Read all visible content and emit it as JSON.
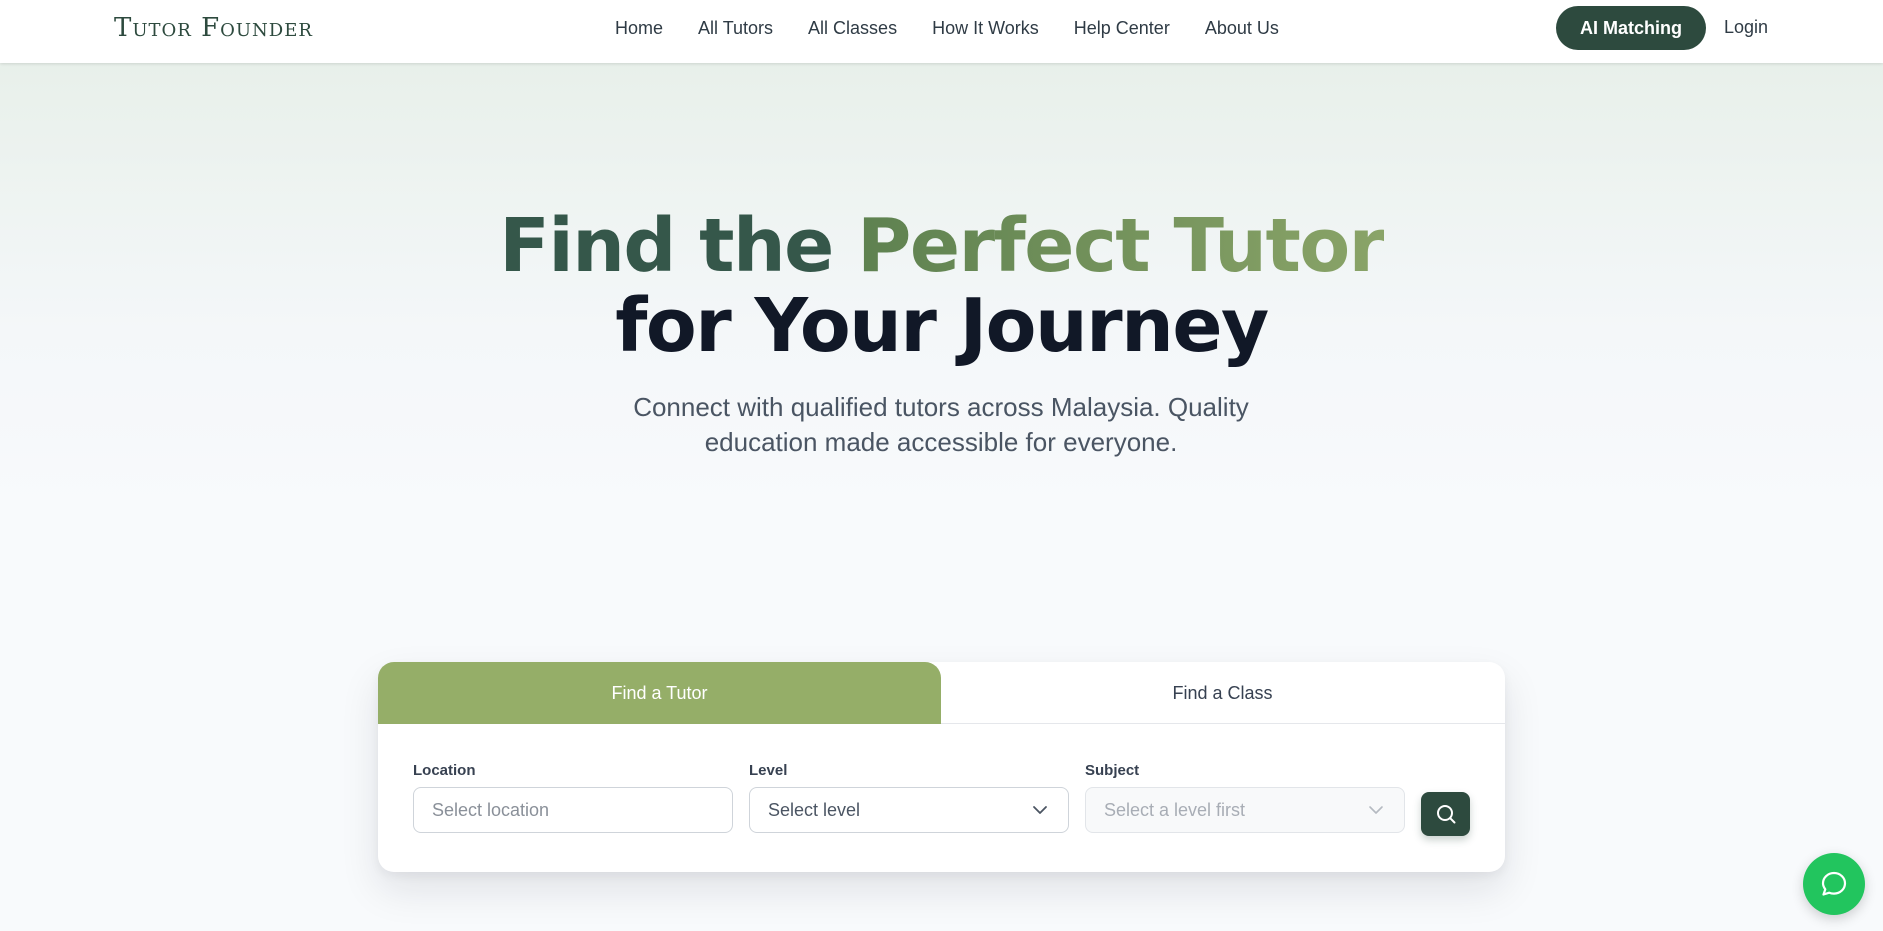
{
  "header": {
    "logo": "Tutor Founder",
    "nav": [
      "Home",
      "All Tutors",
      "All Classes",
      "How It Works",
      "Help Center",
      "About Us"
    ],
    "ai_matching_label": "AI Matching",
    "login_label": "Login"
  },
  "hero": {
    "title_part1": "Find the ",
    "title_accent": "Perfect Tutor",
    "title_line2": "for Your Journey",
    "subtitle": "Connect with qualified tutors across Malaysia. Quality education made accessible for everyone."
  },
  "search": {
    "tabs": [
      "Find a Tutor",
      "Find a Class"
    ],
    "active_tab": "Find a Tutor",
    "location": {
      "label": "Location",
      "placeholder": "Select location"
    },
    "level": {
      "label": "Level",
      "value": "Select level"
    },
    "subject": {
      "label": "Subject",
      "value": "Select a level first"
    },
    "search_icon": "search-icon"
  },
  "chat": {
    "icon": "chat-bubble-icon"
  },
  "colors": {
    "primary": "#2d4a3e",
    "accent": "#95ae68",
    "chat": "#22c55e"
  }
}
